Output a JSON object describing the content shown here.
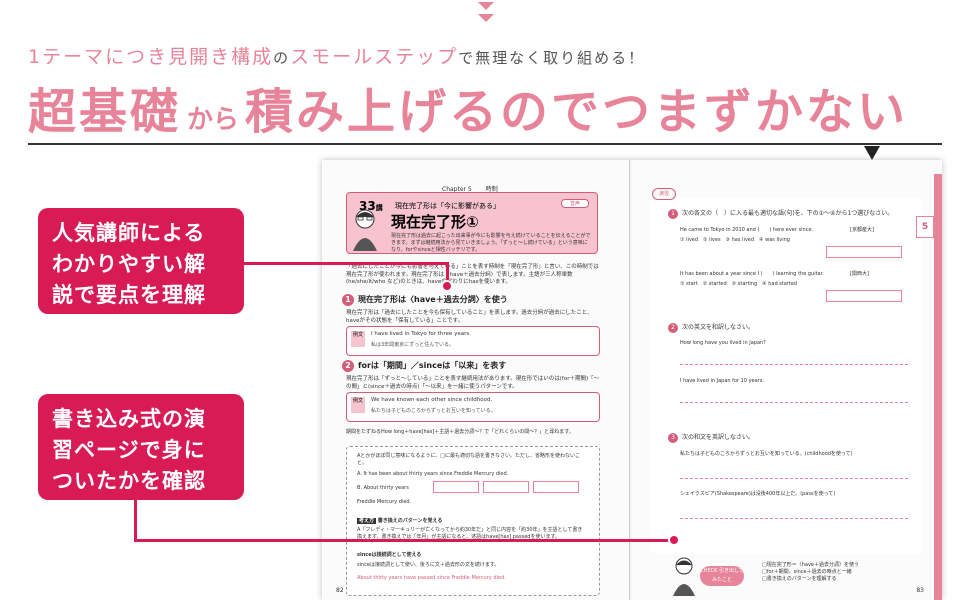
{
  "header": {
    "tagline_parts": [
      "1テーマにつき見開き構成",
      "の",
      "スモールステップ",
      "で無理なく取り組める！"
    ],
    "headline_parts": [
      "超基礎",
      "から",
      "積み上げるのでつまずかない"
    ]
  },
  "callouts": {
    "first": [
      "人気講師による",
      "わかりやすい解",
      "説で要点を理解"
    ],
    "second": [
      "書き込み式の演",
      "習ページで身に",
      "ついたかを確認"
    ]
  },
  "book": {
    "left": {
      "chapter": "Chapter 5",
      "chapter_sub": "時制",
      "lesson_number": "33",
      "lesson_unit": "講",
      "lesson_theme": "現在完了形は「今に影響がある」",
      "lesson_title": "現在完了形①",
      "audio": "音声",
      "lesson_text": "現在完了形は過去に起こった出来事が今にも影響を与え続けていることを伝えることができます。まずは継続用法から見ていきましょう。「ずっと〜し続けている」という意味になり、forやsinceと相性バッチリです。",
      "intro": "「過去にしたことが今にも影響を与えている」ことを表す時制を「現在完了形」と言い、この時制では現在完了形が使われます。現在完了形は〈have＋過去分詞〉で表します。主語が三人称単数(he/she/it/who など)のときは、haveの代わりにhasを使います。",
      "sec1_title": "現在完了形は〈have＋過去分詞〉を使う",
      "sec1_desc": "現在完了形は「過去にしたことを今も保有していること」を表します。過去分詞が過去にしたこと、haveがその状態を「保有している」ことです。",
      "sec1_example_tag": "例文",
      "sec1_example_en": "I have lived in Tokyo for three years.",
      "sec1_example_ja": "私は3年間東京にずっと住んでいる。",
      "sec2_title": "forは「期間」／sinceは「以来」を表す",
      "sec2_desc": "現在完了形は「ずっと〜している」ことを表す継続用法があります。現在形ではいのは(for＋期間)「〜の間」と(since＋過去の時点)「〜以来」を一緒に使うパターンです。",
      "sec2_example_tag": "例文",
      "sec2_example_en": "We have known each other since childhood.",
      "sec2_example_ja": "私たちは子どものころからずっとお互いを知っている。",
      "sec2_note": "期間をたずねるHow long＋have[has]＋主語＋過去分詞〜？で「どれくらいの間〜？」と尋ねます。",
      "exercise_intro": "Aとかがほぼ同じ意味になるように、□に最も適切な語を書きなさい。ただし、省略形を使わないこと。",
      "exercise_a": "A. It has been about thirty years since Freddie Mercury died.",
      "exercise_b": "B. About thirty years",
      "exercise_b2": "Freddie Mercury died.",
      "hint_label": "考え方",
      "hint_title": "書き換えのパターンを覚える",
      "hint_text": "A「フレディ・マーキュリーが亡くなってから約30年だ」と同じ内容を「約30年」を主語として書き換えます。書き換えでは「年月」が主語になると、述語はhave[has] passedを使います。",
      "hint2_title": "sinceは接続詞として使える",
      "hint2_text": "sinceは接続詞として使い、後ろに文＋過去形の文を続けます。",
      "answer_line": "About thirty years have passed since Freddie Mercury died.",
      "page_number_left": "82"
    },
    "right": {
      "header_badge": "演習",
      "q1_title": "次の各文の（　）に入る最も適切な語(句)を、下の①〜④から1つ選びなさい。",
      "q1_a": "He came to Tokyo in 2010 and (　　) here ever since.",
      "q1_a_source": "[京都産大]",
      "q1_a_opts": "① lived　② lives　③ has lived　④ was living",
      "q1_b": "It has been about a year since I (　　) learning the guitar.",
      "q1_b_source": "[関西大]",
      "q1_b_opts": "① start　② started　③ starting　④ had started",
      "q2_title": "次の英文を和訳しなさい。",
      "q2_a": "How long have you lived in Japan?",
      "q2_b": "I have lived in Japan for 10 years.",
      "q3_title": "次の和文を英訳しなさい。",
      "q3_a": "私たちは子どものころからずっとお互いを知っている。(childhoodを使って)",
      "q3_b": "シェイクスピア(Shakespeare)は没後400年以上だ。(passを使って)",
      "check_badge": "CHECK 引き出してみたこと",
      "check_items": [
        "現在完了形＝〈have＋過去分詞〉を使う",
        "for＋期間、since＋過去の時点と一緒",
        "書き換えのパターンを理解する"
      ],
      "side_tab_num": "5",
      "page_number_right": "83"
    }
  },
  "colors": {
    "accent": "#d81b55",
    "pink": "#e8849a"
  }
}
